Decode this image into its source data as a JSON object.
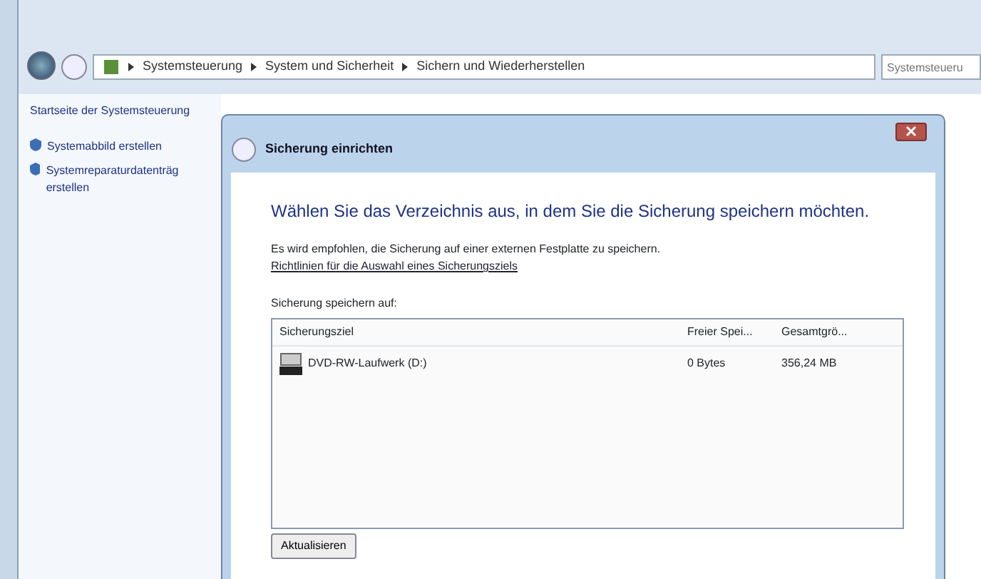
{
  "breadcrumbs": [
    "Systemsteuerung",
    "System und Sicherheit",
    "Sichern und Wiederherstellen"
  ],
  "search": {
    "placeholder": "Systemsteueru"
  },
  "sidebar": {
    "home": "Startseite der Systemsteuerung",
    "items": [
      {
        "label": "Systemabbild erstellen"
      },
      {
        "label": "Systemreparaturdatenträg erstellen"
      }
    ]
  },
  "dialog": {
    "title": "Sicherung einrichten",
    "heading": "Wählen Sie das Verzeichnis aus, in dem Sie die Sicherung speichern möchten.",
    "note": "Es wird empfohlen, die Sicherung auf einer externen Festplatte zu speichern.",
    "link": "Richtlinien für die Auswahl eines Sicherungsziels",
    "list_label": "Sicherung speichern auf:",
    "columns": [
      "Sicherungsziel",
      "Freier Spei...",
      "Gesamtgrö..."
    ],
    "rows": [
      {
        "name": "DVD-RW-Laufwerk (D:)",
        "free": "0 Bytes",
        "total": "356,24 MB"
      }
    ],
    "button": "Aktualisieren"
  }
}
